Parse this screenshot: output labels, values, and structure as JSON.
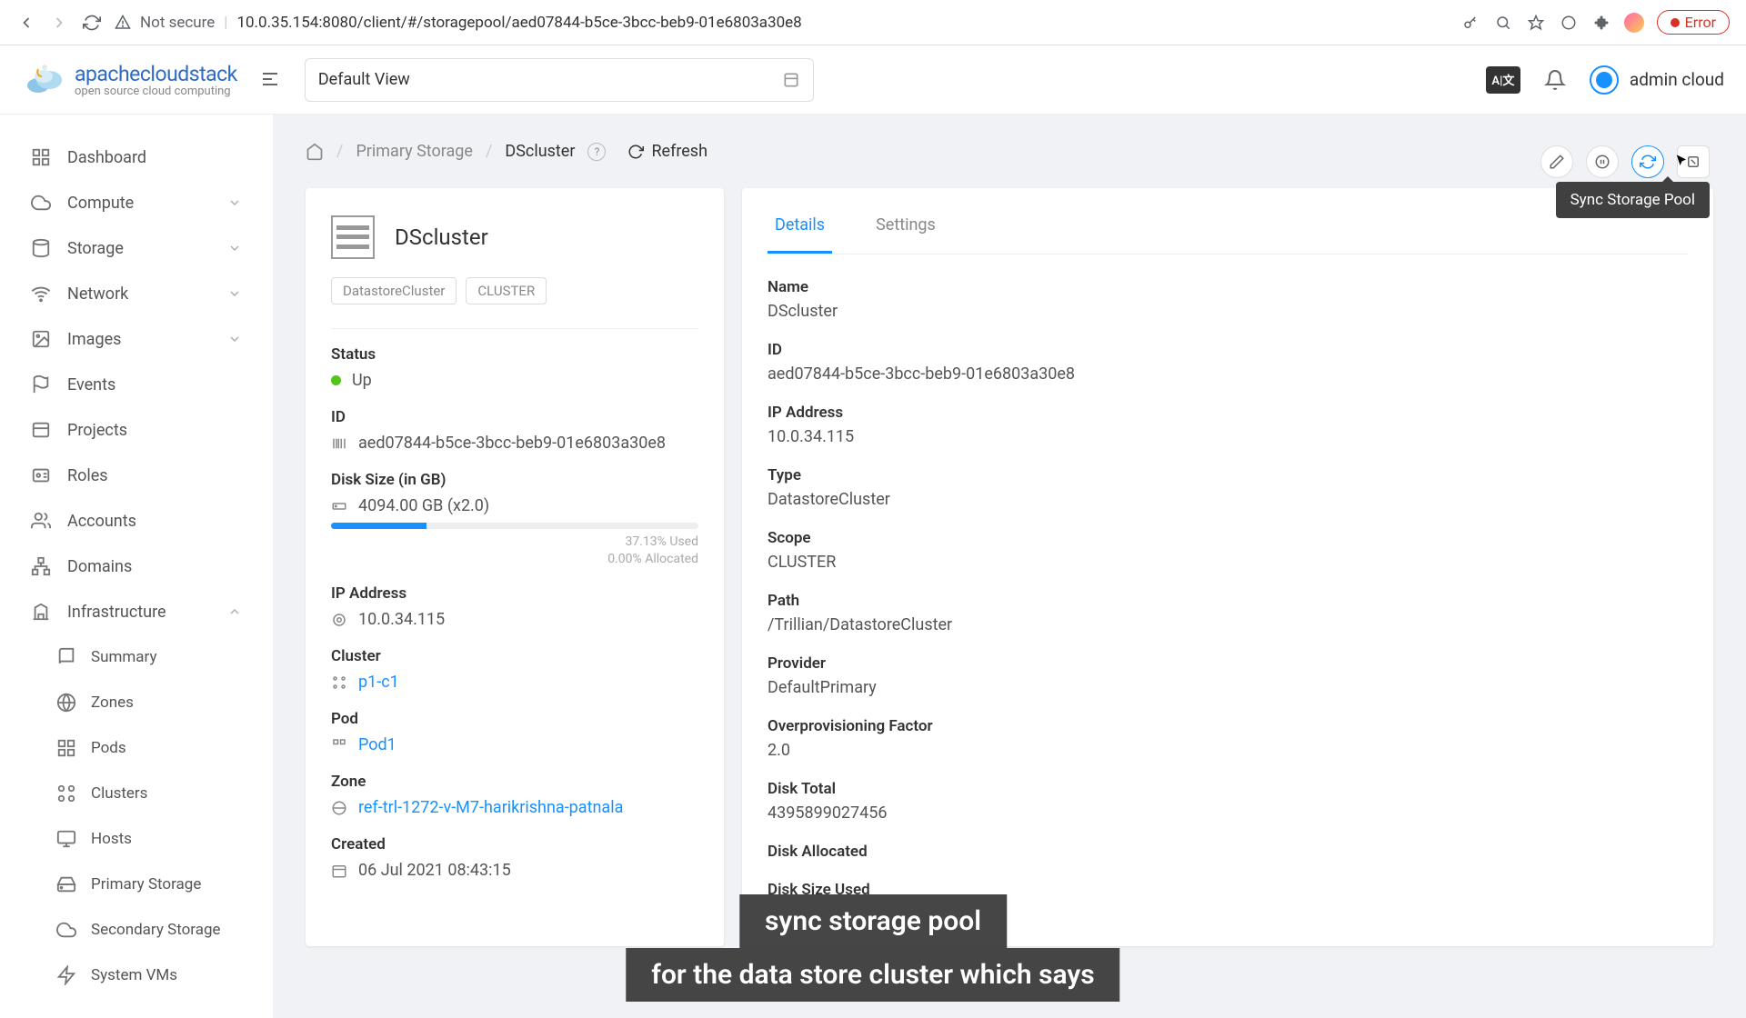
{
  "browser": {
    "not_secure": "Not secure",
    "url": "10.0.35.154:8080/client/#/storagepool/aed07844-b5ce-3bcc-beb9-01e6803a30e8",
    "error": "Error"
  },
  "header": {
    "logo_title": "apachecloudstack",
    "logo_sub": "open source cloud computing",
    "view": "Default View",
    "user": "admin cloud",
    "lang": "A|文"
  },
  "sidebar": {
    "dashboard": "Dashboard",
    "compute": "Compute",
    "storage": "Storage",
    "network": "Network",
    "images": "Images",
    "events": "Events",
    "projects": "Projects",
    "roles": "Roles",
    "accounts": "Accounts",
    "domains": "Domains",
    "infrastructure": "Infrastructure",
    "infra": {
      "summary": "Summary",
      "zones": "Zones",
      "pods": "Pods",
      "clusters": "Clusters",
      "hosts": "Hosts",
      "primary": "Primary Storage",
      "secondary": "Secondary Storage",
      "system_vms": "System VMs"
    }
  },
  "breadcrumb": {
    "l1": "Primary Storage",
    "l2": "DScluster",
    "refresh": "Refresh"
  },
  "tooltip": "Sync Storage Pool",
  "pool": {
    "name": "DScluster",
    "tag1": "DatastoreCluster",
    "tag2": "CLUSTER"
  },
  "summary": {
    "status_lbl": "Status",
    "status_val": "Up",
    "id_lbl": "ID",
    "id_val": "aed07844-b5ce-3bcc-beb9-01e6803a30e8",
    "disk_lbl": "Disk Size (in GB)",
    "disk_val": "4094.00 GB (x2.0)",
    "used": "37.13% Used",
    "alloc": "0.00% Allocated",
    "ip_lbl": "IP Address",
    "ip_val": "10.0.34.115",
    "cluster_lbl": "Cluster",
    "cluster_val": "p1-c1",
    "pod_lbl": "Pod",
    "pod_val": "Pod1",
    "zone_lbl": "Zone",
    "zone_val": "ref-trl-1272-v-M7-harikrishna-patnala",
    "created_lbl": "Created",
    "created_val": "06 Jul 2021 08:43:15"
  },
  "tabs": {
    "details": "Details",
    "settings": "Settings"
  },
  "details": {
    "name_l": "Name",
    "name_v": "DScluster",
    "id_l": "ID",
    "id_v": "aed07844-b5ce-3bcc-beb9-01e6803a30e8",
    "ip_l": "IP Address",
    "ip_v": "10.0.34.115",
    "type_l": "Type",
    "type_v": "DatastoreCluster",
    "scope_l": "Scope",
    "scope_v": "CLUSTER",
    "path_l": "Path",
    "path_v": "/Trillian/DatastoreCluster",
    "provider_l": "Provider",
    "provider_v": "DefaultPrimary",
    "overprov_l": "Overprovisioning Factor",
    "overprov_v": "2.0",
    "dtotal_l": "Disk Total",
    "dtotal_v": "4395899027456",
    "dalloc_l": "Disk Allocated",
    "dused_l": "Disk Size Used"
  },
  "caption": {
    "l1": "sync storage pool",
    "l2": "for the data store cluster which says"
  }
}
